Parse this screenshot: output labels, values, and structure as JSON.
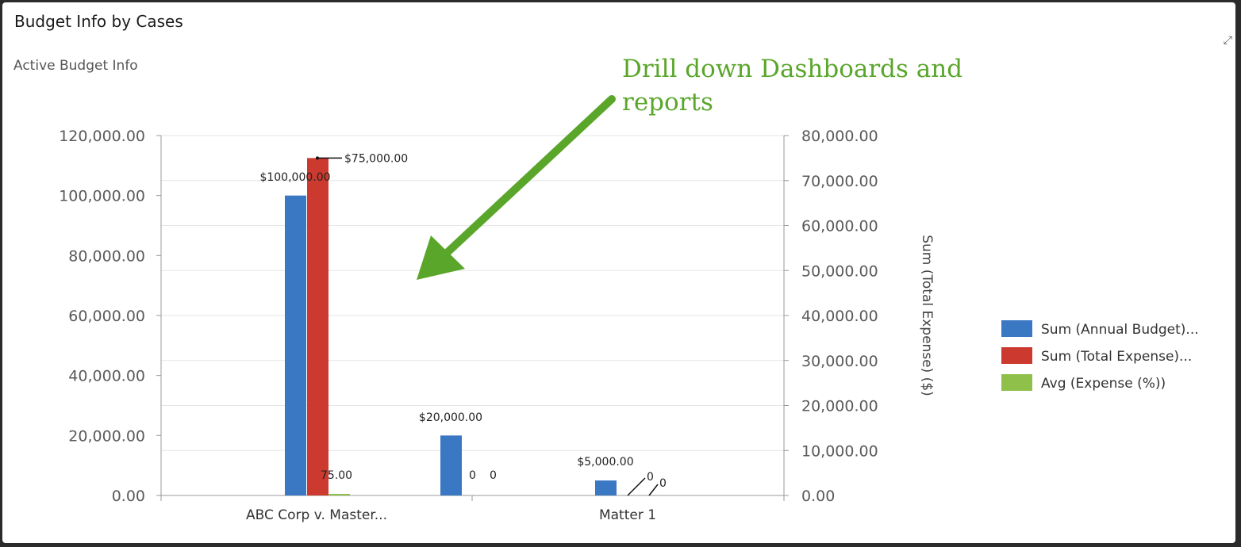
{
  "panel": {
    "title": "Budget Info by Cases",
    "subtitle": "Active Budget Info",
    "corner_icon": "expand-icon"
  },
  "annotation": {
    "lines": [
      "Drill down Dashboards and",
      "reports"
    ],
    "color": "#5aa62b"
  },
  "chart_data": {
    "type": "bar",
    "categories": [
      "ABC Corp v. Master...",
      "Matter 1"
    ],
    "series": [
      {
        "name": "Sum (Annual Budget)...",
        "axis": "left",
        "color": "#3a78c3",
        "values": [
          100000,
          20000,
          5000
        ],
        "labels": [
          "$100,000.00",
          "$20,000.00",
          "$5,000.00"
        ]
      },
      {
        "name": "Sum (Total Expense)...",
        "axis": "right",
        "color": "#cc3a2f",
        "values": [
          75000,
          0,
          0
        ],
        "labels": [
          "$75,000.00",
          "0",
          "0"
        ]
      },
      {
        "name": "Avg (Expense (%))",
        "axis": "left",
        "color": "#8fc04a",
        "values": [
          75,
          0,
          0
        ],
        "labels": [
          "75.00",
          "0",
          "0"
        ]
      }
    ],
    "y_left": {
      "ylim": [
        0,
        120000
      ],
      "ticks": [
        "0.00",
        "20,000.00",
        "40,000.00",
        "60,000.00",
        "80,000.00",
        "100,000.00",
        "120,000.00"
      ]
    },
    "y_right": {
      "ylim": [
        0,
        80000
      ],
      "label": "Sum (Total Expense) ($)",
      "ticks": [
        "0.00",
        "10,000.00",
        "20,000.00",
        "30,000.00",
        "40,000.00",
        "50,000.00",
        "60,000.00",
        "70,000.00",
        "80,000.00"
      ]
    },
    "grid": true,
    "legend": "right"
  }
}
